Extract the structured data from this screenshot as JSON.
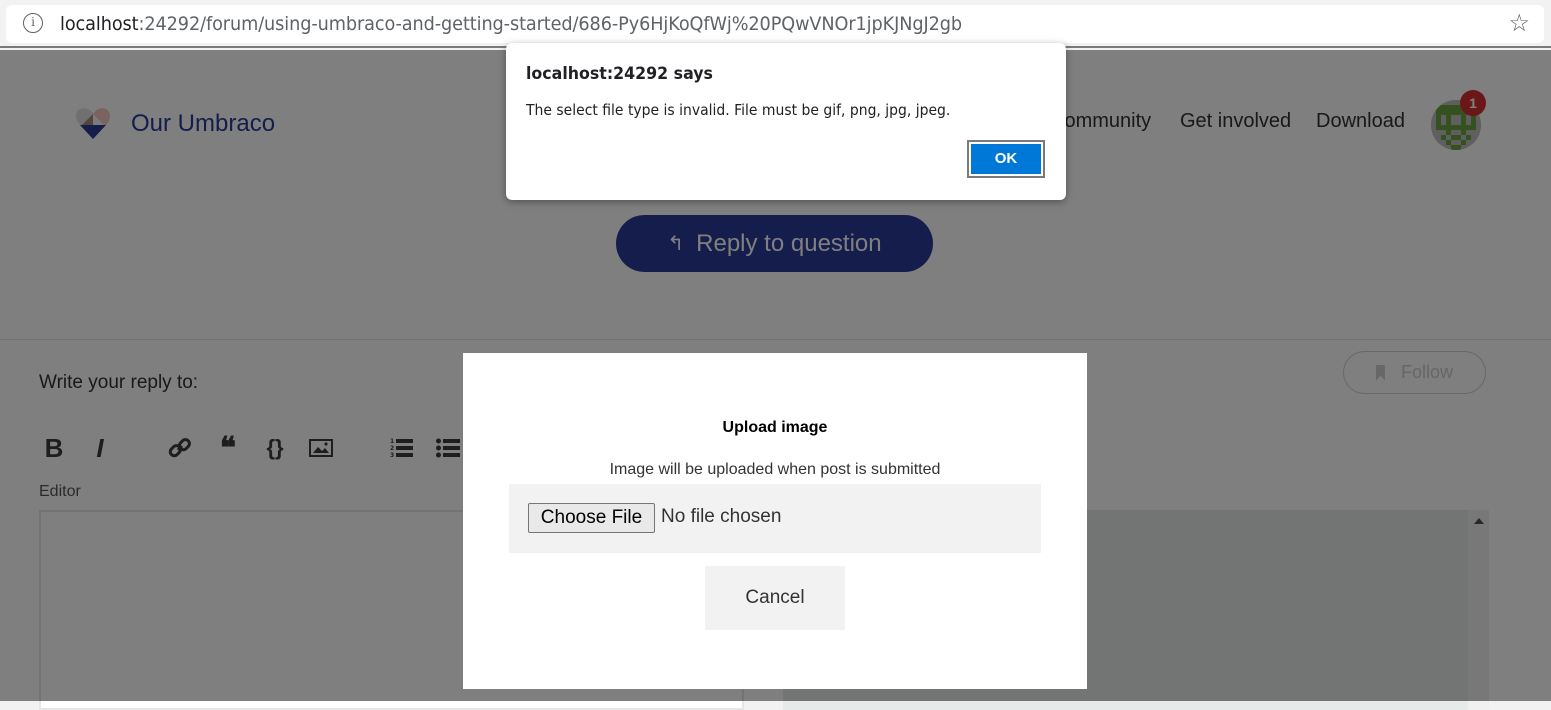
{
  "browser": {
    "url_host": "localhost",
    "url_rest": ":24292/forum/using-umbraco-and-getting-started/686-Py6HjKoQfWj%20PQwVNOr1jpKJNgJ2gb",
    "info_icon": "i",
    "star_icon": "☆"
  },
  "header": {
    "brand": "Our Umbraco",
    "nav": [
      "Community",
      "Get involved",
      "Download"
    ],
    "notification_count": "1",
    "colors": {
      "brand": "#283a97",
      "badge": "#d42f2f",
      "avatar": "#6aa23f"
    }
  },
  "reply_button": {
    "label": "Reply to question",
    "icon": "↰"
  },
  "compose": {
    "write_label": "Write your reply to:",
    "follow_label": "Follow",
    "editor_label": "Editor",
    "toolbar": [
      {
        "name": "bold",
        "glyph": "B"
      },
      {
        "name": "italic",
        "glyph": "I"
      },
      {
        "name": "link",
        "glyph": "🔗"
      },
      {
        "name": "quote",
        "glyph": "❝"
      },
      {
        "name": "code",
        "glyph": "{}"
      },
      {
        "name": "image",
        "glyph": "🖼"
      },
      {
        "name": "ordered-list",
        "glyph": "≡"
      },
      {
        "name": "unordered-list",
        "glyph": "≡"
      }
    ]
  },
  "upload_modal": {
    "title": "Upload image",
    "subtitle": "Image will be uploaded when post is submitted",
    "choose_file_label": "Choose File",
    "no_file_text": "No file chosen",
    "cancel_label": "Cancel"
  },
  "alert": {
    "title": "localhost:24292 says",
    "message": "The select file type is invalid. File must be gif, png, jpg, jpeg.",
    "ok_label": "OK",
    "ok_color": "#0078d7"
  }
}
